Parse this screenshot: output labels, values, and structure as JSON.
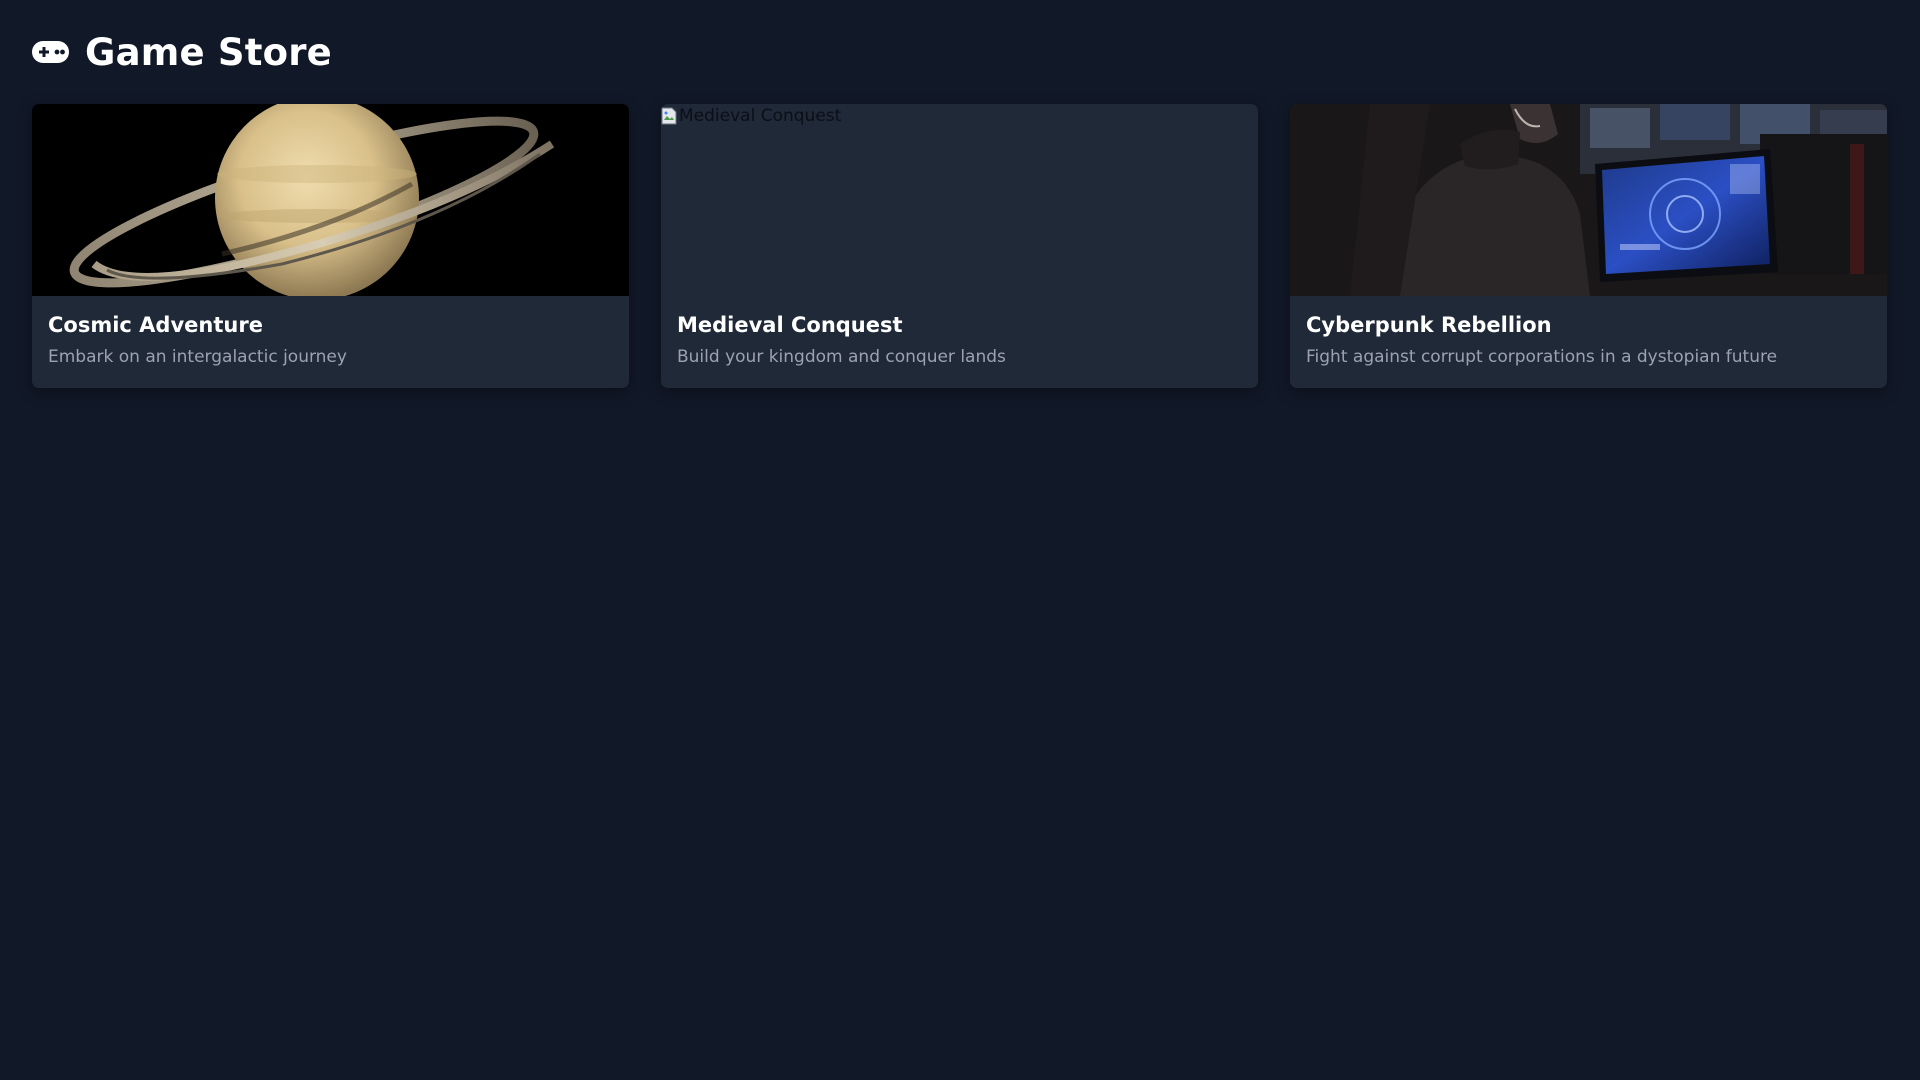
{
  "header": {
    "title": "Game Store",
    "icon": "gamepad-icon"
  },
  "colors": {
    "background": "#111827",
    "card": "#1f2937",
    "title": "#ffffff",
    "description": "#9ca3af"
  },
  "games": [
    {
      "title": "Cosmic Adventure",
      "description": "Embark on an intergalactic journey",
      "image_alt": "Cosmic Adventure"
    },
    {
      "title": "Medieval Conquest",
      "description": "Build your kingdom and conquer lands",
      "image_alt": "Medieval Conquest"
    },
    {
      "title": "Cyberpunk Rebellion",
      "description": "Fight against corrupt corporations in a dystopian future",
      "image_alt": "Cyberpunk Rebellion"
    }
  ]
}
